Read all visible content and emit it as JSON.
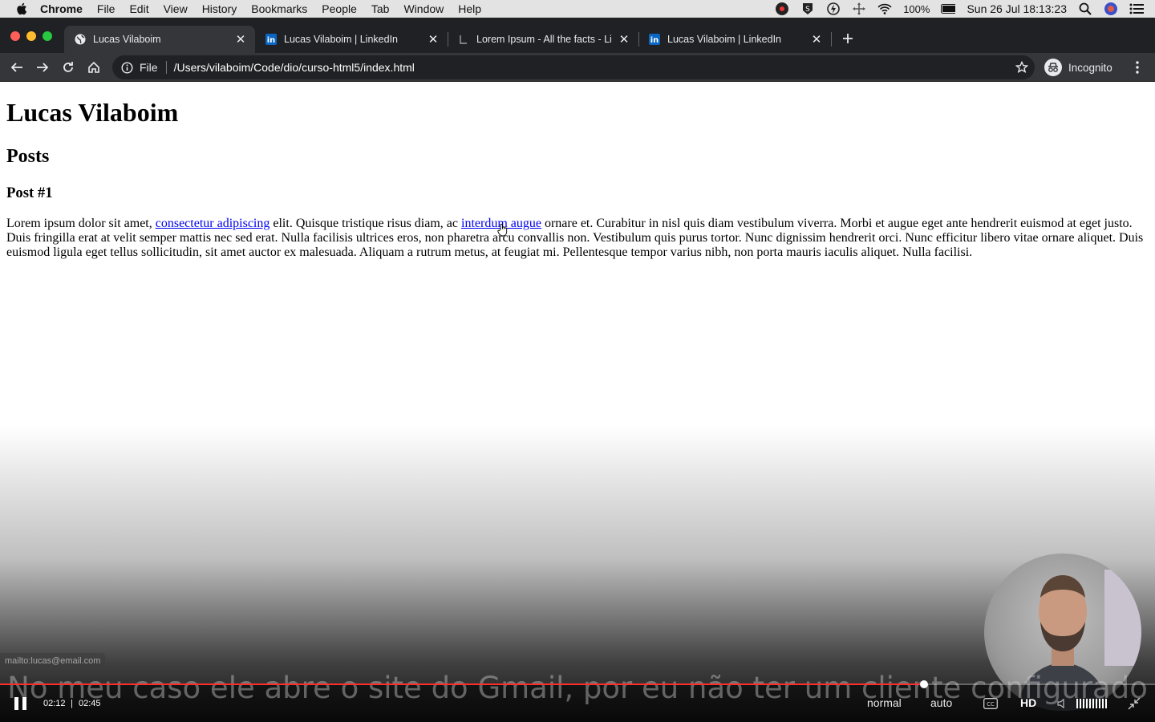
{
  "menubar": {
    "app": "Chrome",
    "items": [
      "File",
      "Edit",
      "View",
      "History",
      "Bookmarks",
      "People",
      "Tab",
      "Window",
      "Help"
    ],
    "battery": "100%",
    "datetime": "Sun 26 Jul  18:13:23"
  },
  "tabs": [
    {
      "title": "Lucas Vilaboim",
      "favicon": "globe-icon",
      "active": true
    },
    {
      "title": "Lucas Vilaboim | LinkedIn",
      "favicon": "linkedin-icon",
      "active": false
    },
    {
      "title": "Lorem Ipsum - All the facts - Li",
      "favicon": "lorem-icon",
      "active": false
    },
    {
      "title": "Lucas Vilaboim | LinkedIn",
      "favicon": "linkedin-icon",
      "active": false
    }
  ],
  "toolbar": {
    "scheme": "File",
    "url": "/Users/vilaboim/Code/dio/curso-html5/index.html",
    "profile": "Incognito"
  },
  "page": {
    "h1": "Lucas Vilaboim",
    "h2": "Posts",
    "h3": "Post #1",
    "p_part1": "Lorem ipsum dolor sit amet, ",
    "link1": "consectetur adipiscing",
    "p_part2": " elit. Quisque tristique risus diam, ac ",
    "link2": "interdum augue",
    "p_part3": " ornare et. Curabitur in nisl quis diam vestibulum viverra. Morbi et augue eget ante hendrerit euismod at eget justo. Duis fringilla erat at velit semper mattis nec sed erat. Nulla facilisis ultrices eros, non pharetra arcu convallis non. Vestibulum quis purus tortor. Nunc dignissim hendrerit orci. Nunc efficitur libero vitae ornare aliquet. Duis euismod ligula eget tellus sollicitudin, sit amet auctor ex malesuada. Aliquam a rutrum metus, at feugiat mi. Pellentesque tempor varius nibh, non porta mauris iaculis aliquet. Nulla facilisi."
  },
  "status_url": "mailto:lucas@email.com",
  "video": {
    "subtitle": "No meu caso ele abre o site do Gmail, por eu não ter um cliente configurado",
    "current_time": "02:12",
    "separator": "|",
    "duration": "02:45",
    "progress": 0.8,
    "speed": "normal",
    "quality_mode": "auto",
    "hd": "HD"
  },
  "colors": {
    "tabstrip": "#202124",
    "toolbar": "#35363a",
    "link": "#0000ee",
    "progress": "#ff2e2e"
  }
}
